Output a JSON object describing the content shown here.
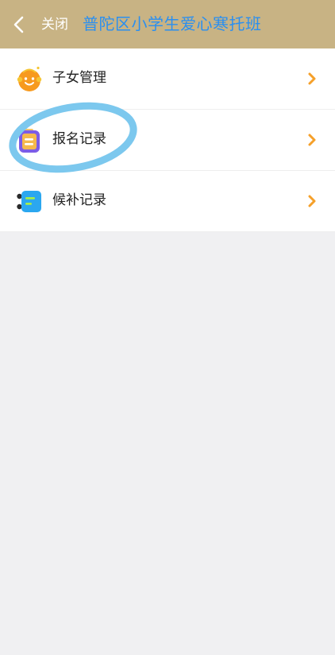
{
  "header": {
    "close_label": "关闭",
    "title": "普陀区小学生爱心寒托班"
  },
  "menu": {
    "items": [
      {
        "label": "子女管理",
        "icon": "child-face-icon"
      },
      {
        "label": "报名记录",
        "icon": "registration-list-icon"
      },
      {
        "label": "候补记录",
        "icon": "waitlist-icon"
      }
    ]
  },
  "colors": {
    "header_bg": "#c8b384",
    "title": "#2a8ff0",
    "chevron": "#f5a02a",
    "annotation_circle": "#7cc8ee"
  }
}
